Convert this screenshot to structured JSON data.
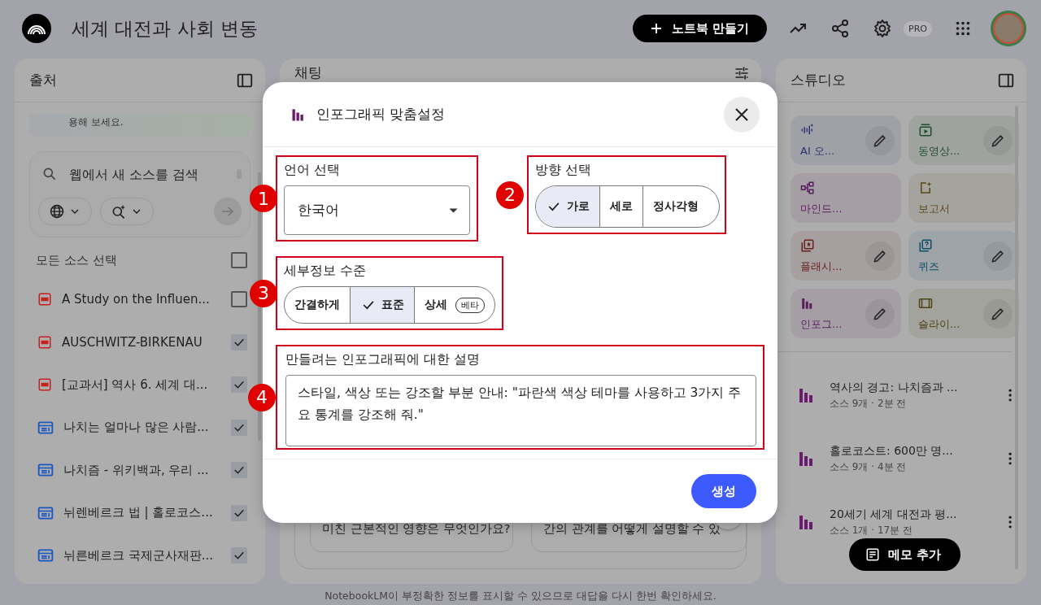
{
  "header": {
    "title": "세계 대전과 사회 변동",
    "create_button": "노트북 만들기",
    "plan_badge": "PRO"
  },
  "sources": {
    "title": "출처",
    "notice": "용해 보세요.",
    "search": {
      "placeholder": "웹에서 새 소스를 검색"
    },
    "select_all": {
      "label": "모든 소스 선택",
      "checked": false
    },
    "items": [
      {
        "kind": "pdf",
        "title": "A Study on the Influen...",
        "checked": false
      },
      {
        "kind": "pdf",
        "title": "AUSCHWITZ-BIRKENAU",
        "checked": true
      },
      {
        "kind": "pdf",
        "title": "[교과서] 역사 6. 세계 대...",
        "checked": true
      },
      {
        "kind": "web",
        "title": "나치는 얼마나 많은 사람...",
        "checked": true
      },
      {
        "kind": "web",
        "title": "나치즘 - 위키백과, 우리 ...",
        "checked": true
      },
      {
        "kind": "web",
        "title": "뉘렌베르크 법 | 홀로코스...",
        "checked": true
      },
      {
        "kind": "web",
        "title": "뉘른베르크 국제군사재판...",
        "checked": true
      }
    ]
  },
  "chat": {
    "title": "채팅",
    "suggestions": [
      "미친 근본적인 영향은 무엇인가요?",
      "간의 관계를 어떻게 설명할 수 있"
    ],
    "disclaimer": "NotebookLM이 부정확한 정보를 표시할 수 있으므로 대답을 다시 한번 확인하세요."
  },
  "studio": {
    "title": "스튜디오",
    "tools": [
      {
        "kind": "audio",
        "label": "AI 오...",
        "color": "#2a3570",
        "editable": true
      },
      {
        "kind": "video",
        "label": "동영상...",
        "color": "#1f4d2c",
        "editable": true
      },
      {
        "kind": "mindmap",
        "label": "마인드...",
        "color": "#5a1e5e",
        "editable": false
      },
      {
        "kind": "report",
        "label": "보고서",
        "color": "#5a4718",
        "editable": false
      },
      {
        "kind": "flashcard",
        "label": "플래시...",
        "color": "#6a1f1f",
        "editable": true
      },
      {
        "kind": "quiz",
        "label": "퀴즈",
        "color": "#0e4d66",
        "editable": true
      },
      {
        "kind": "infographic",
        "label": "인포그...",
        "color": "#5a1e5e",
        "editable": true
      },
      {
        "kind": "slides",
        "label": "슬라이...",
        "color": "#4d4418",
        "editable": true
      }
    ],
    "notes": [
      {
        "title": "역사의 경고: 나치즘과 ...",
        "meta": "소스 9개 · 2분 전"
      },
      {
        "title": "홀로코스트: 600만 명...",
        "meta": "소스 9개 · 4분 전"
      },
      {
        "title": "20세기 세계 대전과 평...",
        "meta": "소스 1개 · 17분 전"
      }
    ],
    "add_note_button": "메모 추가"
  },
  "dialog": {
    "title": "인포그래픽 맞춤설정",
    "language": {
      "callout": "1",
      "label": "언어 선택",
      "value": "한국어"
    },
    "orientation": {
      "callout": "2",
      "label": "방향 선택",
      "options": [
        {
          "label": "가로",
          "selected": true
        },
        {
          "label": "세로",
          "selected": false
        },
        {
          "label": "정사각형",
          "selected": false
        }
      ]
    },
    "detail": {
      "callout": "3",
      "label": "세부정보 수준",
      "options": [
        {
          "label": "간결하게",
          "selected": false
        },
        {
          "label": "표준",
          "selected": true
        },
        {
          "label": "상세",
          "selected": false,
          "badge": "베타"
        }
      ]
    },
    "description": {
      "callout": "4",
      "label": "만들려는 인포그래픽에 대한 설명",
      "value": "스타일, 색상 또는 강조할 부분 안내: \"파란색 색상 테마를 사용하고 3가지 주요 통계를 강조해 줘.\""
    },
    "submit_button": "생성"
  }
}
